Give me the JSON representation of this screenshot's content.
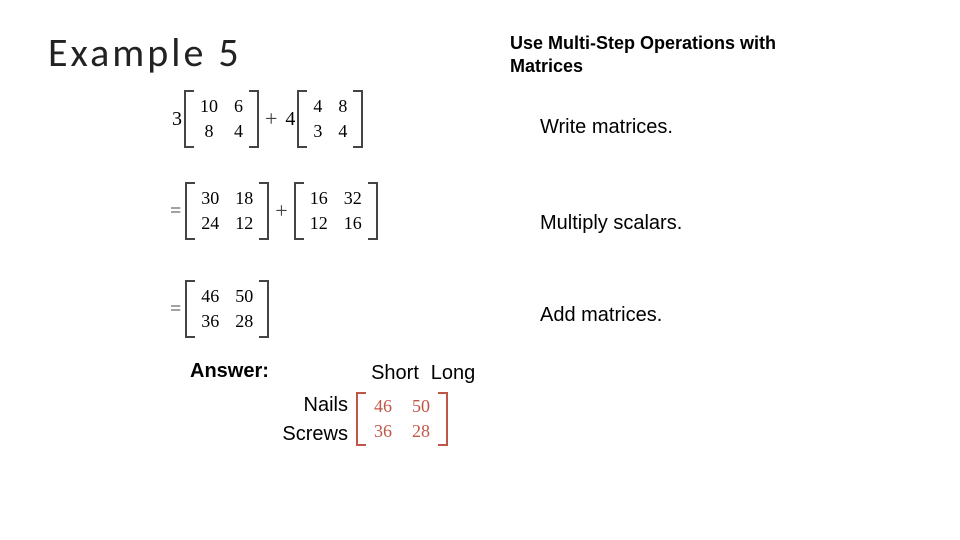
{
  "title": "Example 5",
  "subtitle": "Use Multi-Step Operations with Matrices",
  "captions": {
    "write": "Write matrices.",
    "multiply": "Multiply scalars.",
    "add": "Add matrices."
  },
  "step1": {
    "scalar_a": "3",
    "matrix_a": [
      [
        "10",
        "6"
      ],
      [
        "8",
        "4"
      ]
    ],
    "op": "+",
    "scalar_b": "4",
    "matrix_b": [
      [
        "4",
        "8"
      ],
      [
        "3",
        "4"
      ]
    ]
  },
  "step2": {
    "eq": "=",
    "matrix_a": [
      [
        "30",
        "18"
      ],
      [
        "24",
        "12"
      ]
    ],
    "op": "+",
    "matrix_b": [
      [
        "16",
        "32"
      ],
      [
        "12",
        "16"
      ]
    ]
  },
  "step3": {
    "eq": "=",
    "matrix": [
      [
        "46",
        "50"
      ],
      [
        "36",
        "28"
      ]
    ]
  },
  "answer": {
    "label": "Answer:",
    "col_headers": [
      "Short",
      "Long"
    ],
    "row_headers": [
      "Nails",
      "Screws"
    ],
    "matrix": [
      [
        "46",
        "50"
      ],
      [
        "36",
        "28"
      ]
    ]
  },
  "chart_data": {
    "type": "table",
    "title": "Answer matrix",
    "row_labels": [
      "Nails",
      "Screws"
    ],
    "col_labels": [
      "Short",
      "Long"
    ],
    "values": [
      [
        46,
        50
      ],
      [
        36,
        28
      ]
    ]
  }
}
